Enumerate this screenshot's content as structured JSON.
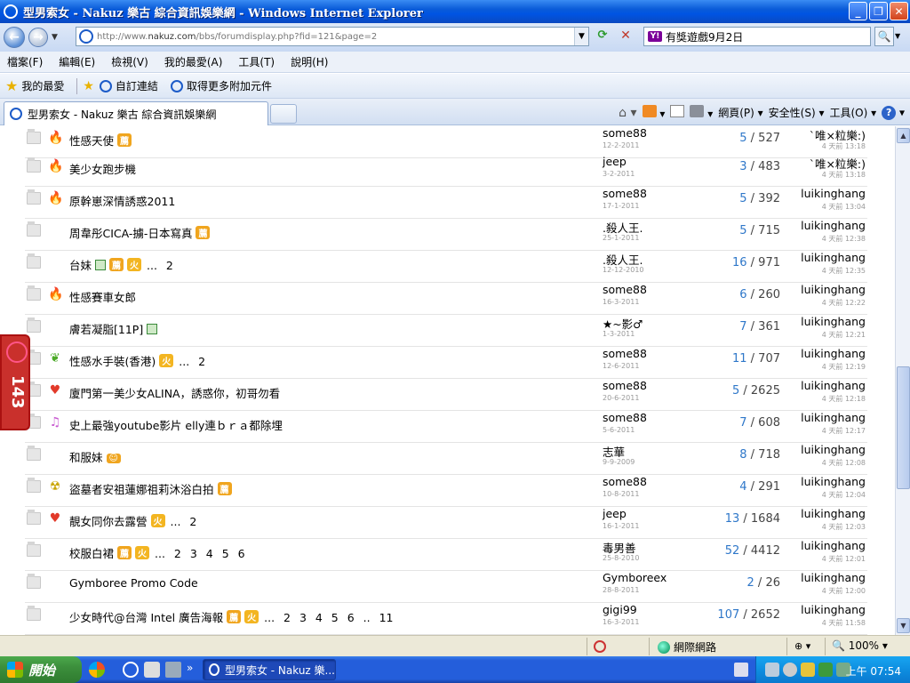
{
  "window": {
    "title": "型男索女 - Nakuz 樂古 綜合資訊娛樂網 - Windows Internet Explorer"
  },
  "address_bar": {
    "url_prefix": "http://www.",
    "url_domain": "nakuz.com",
    "url_path": "/bbs/forumdisplay.php?fid=121&page=2"
  },
  "search": {
    "value": "有獎遊戲9月2日"
  },
  "menu": [
    "檔案(F)",
    "編輯(E)",
    "檢視(V)",
    "我的最愛(A)",
    "工具(T)",
    "說明(H)"
  ],
  "favorites_bar": {
    "favorites": "我的最愛",
    "custom_links": "自訂連結",
    "get_addons": "取得更多附加元件"
  },
  "tab": {
    "title": "型男索女 - Nakuz 樂古 綜合資訊娛樂網"
  },
  "command_bar": {
    "page": "網頁(P)",
    "safety": "安全性(S)",
    "tools": "工具(O)"
  },
  "side_badge": {
    "count": "143"
  },
  "threads": [
    {
      "icon": "fire-icon",
      "title": "性感天使",
      "badges": [
        "薦"
      ],
      "pages": "",
      "author": "some88",
      "date": "12-2-2011",
      "replies": "5",
      "views": "527",
      "last": "`唯×粒樂:)",
      "time": "4 天前 13:18"
    },
    {
      "icon": "fire-icon",
      "title": "美少女跑步機",
      "badges": [],
      "pages": "",
      "author": "jeep",
      "date": "3-2-2011",
      "replies": "3",
      "views": "483",
      "last": "`唯×粒樂:)",
      "time": "4 天前 13:18"
    },
    {
      "icon": "fire-icon",
      "title": "原幹崽深情誘惑2011",
      "badges": [],
      "pages": "",
      "author": "some88",
      "date": "17-1-2011",
      "replies": "5",
      "views": "392",
      "last": "luikinghang",
      "time": "4 天前 13:04"
    },
    {
      "icon": "",
      "title": "周韋彤CICA-擄-日本寫真",
      "badges": [
        "薦"
      ],
      "pages": "",
      "author": ".殺人王.",
      "date": "25-1-2011",
      "replies": "5",
      "views": "715",
      "last": "luikinghang",
      "time": "4 天前 12:38"
    },
    {
      "icon": "",
      "title": "台妹",
      "img": true,
      "badges": [
        "薦",
        "火"
      ],
      "pages": "... 2",
      "author": ".殺人王.",
      "date": "12-12-2010",
      "replies": "16",
      "views": "971",
      "last": "luikinghang",
      "time": "4 天前 12:35"
    },
    {
      "icon": "fire-icon",
      "title": "性感賽車女郎",
      "badges": [],
      "pages": "",
      "author": "some88",
      "date": "16-3-2011",
      "replies": "6",
      "views": "260",
      "last": "luikinghang",
      "time": "4 天前 12:22"
    },
    {
      "icon": "",
      "title": "膚若凝脂[11P]",
      "img": true,
      "badges": [],
      "pages": "",
      "author": "★~影♂",
      "date": "1-3-2011",
      "replies": "7",
      "views": "361",
      "last": "luikinghang",
      "time": "4 天前 12:21"
    },
    {
      "icon": "leaf-icon",
      "title": "性感水手裝(香港)",
      "badges": [
        "火"
      ],
      "pages": "... 2",
      "author": "some88",
      "date": "12-6-2011",
      "replies": "11",
      "views": "707",
      "last": "luikinghang",
      "time": "4 天前 12:19"
    },
    {
      "icon": "heart-icon",
      "title": "廈門第一美少女ALINA，誘惑你，初哥勿看",
      "badges": [],
      "pages": "",
      "author": "some88",
      "date": "20-6-2011",
      "replies": "5",
      "views": "2625",
      "last": "luikinghang",
      "time": "4 天前 12:18"
    },
    {
      "icon": "music-note-icon",
      "title": "史上最強youtube影片 elly連ｂｒａ都除埋",
      "badges": [],
      "pages": "",
      "author": "some88",
      "date": "5-6-2011",
      "replies": "7",
      "views": "608",
      "last": "luikinghang",
      "time": "4 天前 12:17"
    },
    {
      "icon": "",
      "title": "和服妹",
      "badges": [
        "☺"
      ],
      "pages": "",
      "author": "志華",
      "date": "9-9-2009",
      "replies": "8",
      "views": "718",
      "last": "luikinghang",
      "time": "4 天前 12:08"
    },
    {
      "icon": "radiation-icon",
      "title": "盜墓者安祖蓮娜祖莉沐浴白拍",
      "badges": [
        "薦"
      ],
      "pages": "",
      "author": "some88",
      "date": "10-8-2011",
      "replies": "4",
      "views": "291",
      "last": "luikinghang",
      "time": "4 天前 12:04"
    },
    {
      "icon": "heart-icon",
      "title": "靚女同你去露營",
      "badges": [
        "火"
      ],
      "pages": "... 2",
      "author": "jeep",
      "date": "16-1-2011",
      "replies": "13",
      "views": "1684",
      "last": "luikinghang",
      "time": "4 天前 12:03"
    },
    {
      "icon": "",
      "title": "校服白裙",
      "badges": [
        "薦",
        "火"
      ],
      "pages": "... 2 3 4 5 6",
      "author": "毒男善",
      "date": "25-8-2010",
      "replies": "52",
      "views": "4412",
      "last": "luikinghang",
      "time": "4 天前 12:01"
    },
    {
      "icon": "",
      "title": "Gymboree Promo Code",
      "badges": [],
      "pages": "",
      "author": "Gymboreex",
      "date": "28-8-2011",
      "replies": "2",
      "views": "26",
      "last": "luikinghang",
      "time": "4 天前 12:00"
    },
    {
      "icon": "",
      "title": "少女時代@台灣 Intel 廣告海報",
      "badges": [
        "薦",
        "火"
      ],
      "pages": "... 2 3 4 5 6 .. 11",
      "author": "gigi99",
      "date": "16-3-2011",
      "replies": "107",
      "views": "2652",
      "last": "luikinghang",
      "time": "4 天前 11:58"
    }
  ],
  "status_bar": {
    "zone": "網際網路",
    "zoom": "100%"
  },
  "taskbar": {
    "start": "開始",
    "task": "型男索女 - Nakuz 樂...",
    "clock": "上午 07:54"
  }
}
